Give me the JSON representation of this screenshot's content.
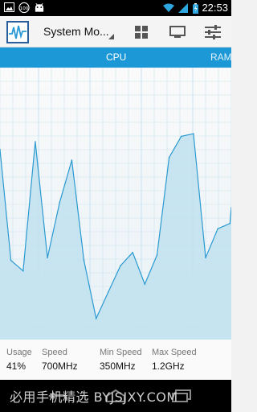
{
  "status_bar": {
    "time": "22:53",
    "notification_badge": "100",
    "icons": [
      "image-icon",
      "badge-icon",
      "android-icon",
      "wifi-icon",
      "signal-icon",
      "battery-icon"
    ]
  },
  "action_bar": {
    "title": "System Mo...",
    "actions": [
      "widgets-icon",
      "monitor-icon",
      "settings-sliders-icon"
    ]
  },
  "tabs": [
    {
      "label": "CPU",
      "selected": true
    },
    {
      "label": "RAM",
      "selected": false
    }
  ],
  "chart_data": {
    "type": "area",
    "x": [
      0,
      1,
      2,
      3,
      4,
      5,
      6,
      7,
      8,
      9,
      10,
      11,
      12,
      13,
      14,
      15,
      16,
      17,
      18,
      19,
      20
    ],
    "values": [
      72,
      30,
      26,
      75,
      31,
      52,
      68,
      30,
      8,
      18,
      28,
      33,
      21,
      32,
      69,
      77,
      78,
      31,
      42,
      44,
      50
    ],
    "ylim": [
      0,
      100
    ],
    "grid": true,
    "fill_color": "#bfe0ef",
    "line_color": "#2b9ad1",
    "grid_color": "#c9e3f0"
  },
  "stats": [
    {
      "label": "Usage",
      "value": "41%"
    },
    {
      "label": "Speed",
      "value": "700MHz"
    },
    {
      "label": "Min Speed",
      "value": "350MHz"
    },
    {
      "label": "Max Speed",
      "value": "1.2GHz"
    }
  ],
  "watermark": "必用手机精选 BYJSJXY.COM",
  "nav_bar": {
    "buttons": [
      "back-icon",
      "home-icon",
      "recents-icon"
    ]
  },
  "colors": {
    "accent": "#1c98d6",
    "status_bar": "#000000"
  }
}
